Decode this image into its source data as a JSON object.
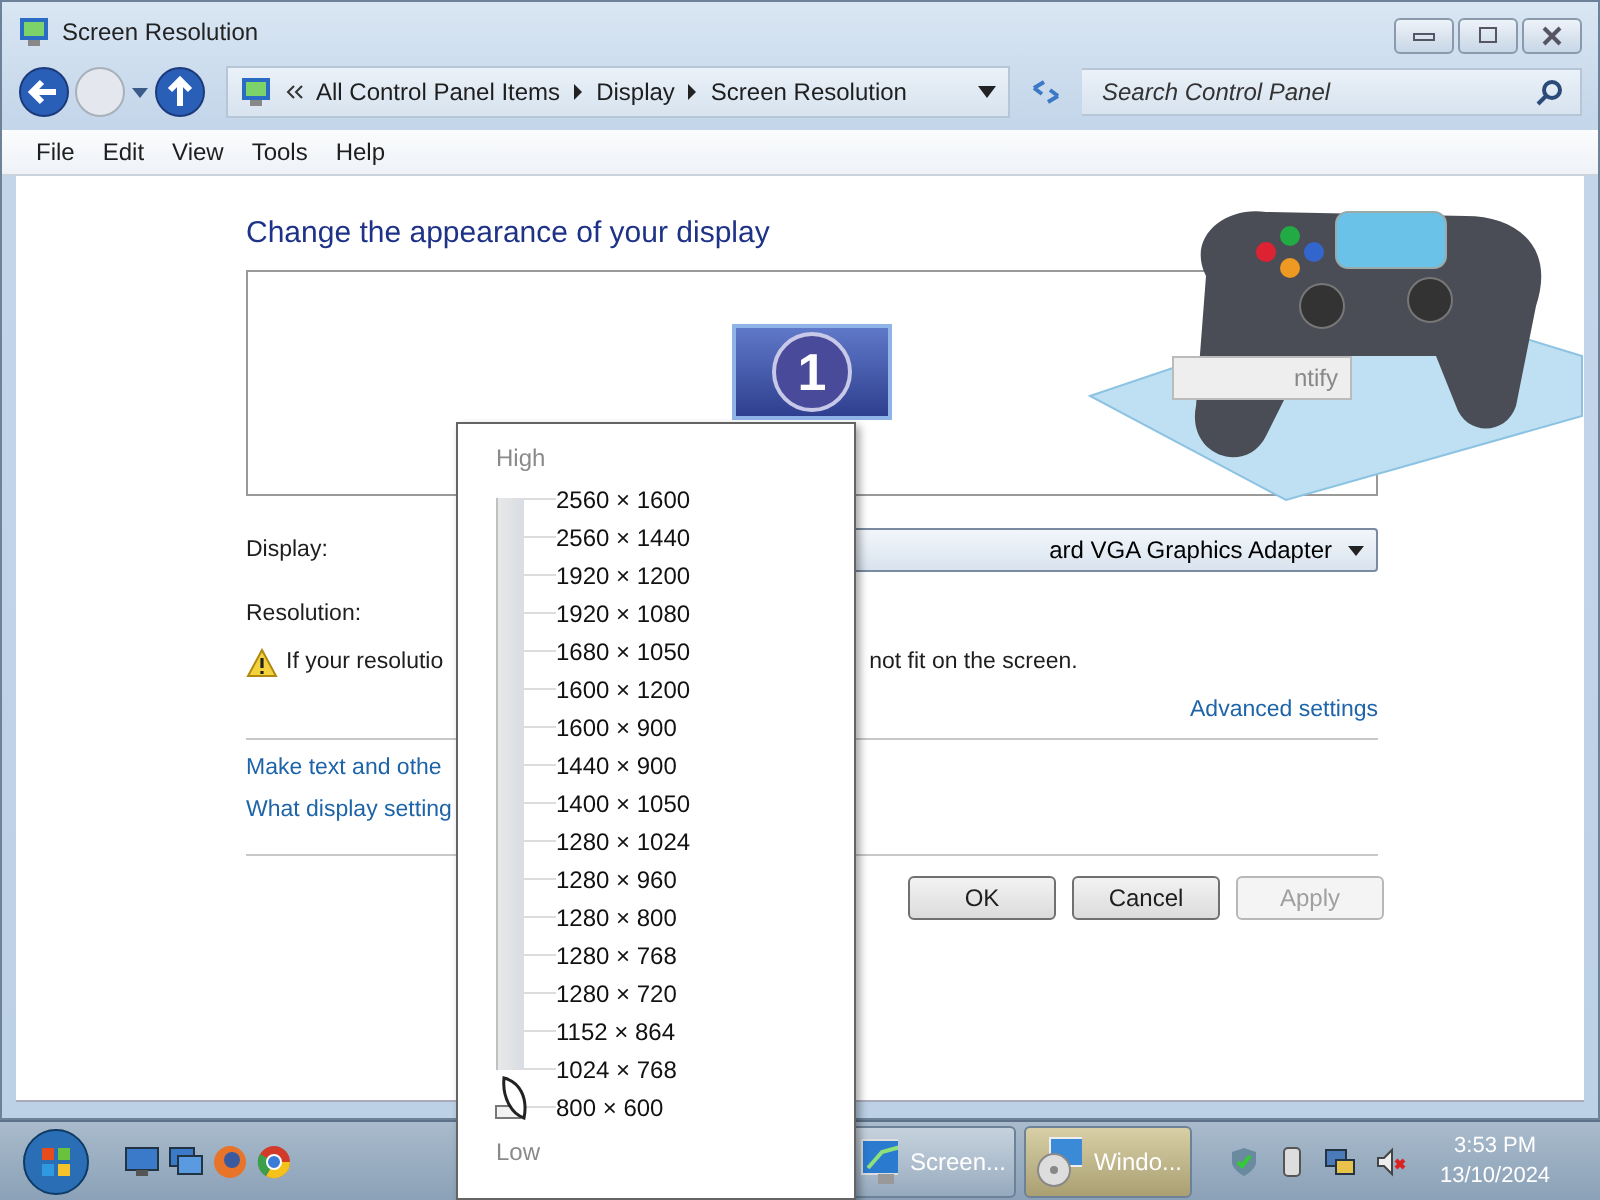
{
  "window": {
    "title": "Screen Resolution"
  },
  "navigation": {
    "breadcrumbs": [
      "All Control Panel Items",
      "Display",
      "Screen Resolution"
    ],
    "search": {
      "placeholder": "Search Control Panel"
    }
  },
  "menu": [
    "File",
    "Edit",
    "View",
    "Tools",
    "Help"
  ],
  "content": {
    "heading": "Change the appearance of your display",
    "monitor": {
      "number": "1"
    },
    "identify_button": "ntify",
    "display": {
      "label": "Display:",
      "value": "ard VGA Graphics Adapter"
    },
    "resolution": {
      "label": "Resolution:"
    },
    "warning": {
      "before": "If your resolutio",
      "after": "not fit on the screen."
    },
    "advanced_link": "Advanced settings",
    "links": [
      "Make text and othe",
      "What display setting"
    ]
  },
  "buttons": [
    {
      "label": "OK",
      "disabled": false
    },
    {
      "label": "Cancel",
      "disabled": false
    },
    {
      "label": "Apply",
      "disabled": true
    }
  ],
  "resolution_popup": {
    "high_label": "High",
    "low_label": "Low",
    "level": 0,
    "options": [
      "2560 × 1600",
      "2560 × 1440",
      "1920 × 1200",
      "1920 × 1080",
      "1680 × 1050",
      "1600 × 1200",
      "1600 × 900",
      "1440 × 900",
      "1400 × 1050",
      "1280 × 1024",
      "1280 × 960",
      "1280 × 800",
      "1280 × 768",
      "1280 × 720",
      "1152 × 864",
      "1024 × 768",
      "800 × 600"
    ]
  },
  "taskbar": {
    "windows": [
      {
        "label": "Screen...",
        "selected": false
      },
      {
        "label": "Windo...",
        "selected": true
      }
    ],
    "clock": {
      "time": "3:53 PM",
      "date": "13/10/2024"
    }
  }
}
